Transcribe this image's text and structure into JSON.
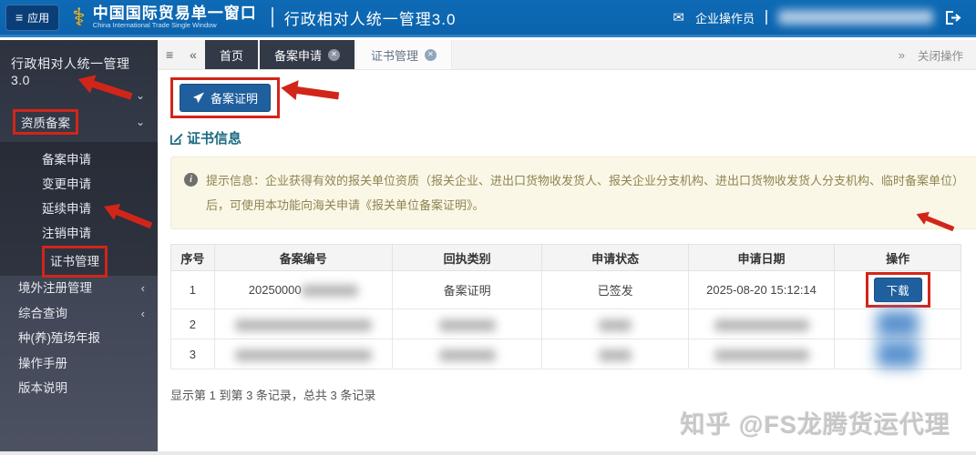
{
  "header": {
    "app_button": "应用",
    "brand_title": "中国国际贸易单一窗口",
    "brand_subtitle": "China International Trade Single Window",
    "divider": "|",
    "system_title": "行政相对人统一管理3.0",
    "user_role": "企业操作员"
  },
  "sidebar": {
    "root_title": "行政相对人统一管理3.0",
    "section_label": "资质备案",
    "submenu": [
      "备案申请",
      "变更申请",
      "延续申请",
      "注销申请",
      "证书管理"
    ],
    "items": [
      {
        "label": "境外注册管理",
        "chevron": "‹"
      },
      {
        "label": "综合查询",
        "chevron": "‹"
      },
      {
        "label": "种(养)殖场年报",
        "chevron": ""
      },
      {
        "label": "操作手册",
        "chevron": ""
      },
      {
        "label": "版本说明",
        "chevron": ""
      }
    ]
  },
  "tabs": {
    "home": "首页",
    "filing": "备案申请",
    "certificate": "证书管理",
    "close_ops": "关闭操作"
  },
  "toolbar": {
    "filing_cert_button": "备案证明"
  },
  "section": {
    "title": "证书信息"
  },
  "notice": {
    "text": "提示信息：企业获得有效的报关单位资质（报关企业、进出口货物收发货人、报关企业分支机构、进出口货物收发货人分支机构、临时备案单位）后，可使用本功能向海关申请《报关单位备案证明》。"
  },
  "table": {
    "headers": [
      "序号",
      "备案编号",
      "回执类别",
      "申请状态",
      "申请日期",
      "操作"
    ],
    "rows": [
      {
        "seq": "1",
        "record_no": "20250000",
        "receipt_type": "备案证明",
        "status": "已签发",
        "date": "2025-08-20 15:12:14",
        "action": "下载"
      },
      {
        "seq": "2"
      },
      {
        "seq": "3"
      }
    ],
    "summary": "显示第 1 到第 3 条记录，总共 3 条记录"
  },
  "watermark": "知乎 @FS龙腾货运代理",
  "colors": {
    "header_blue": "#0d67b3",
    "accent_blue": "#1f5f9e",
    "annotation_red": "#d2251a",
    "notice_bg": "#fbf7e6",
    "sidebar_dark": "#3a4150"
  }
}
